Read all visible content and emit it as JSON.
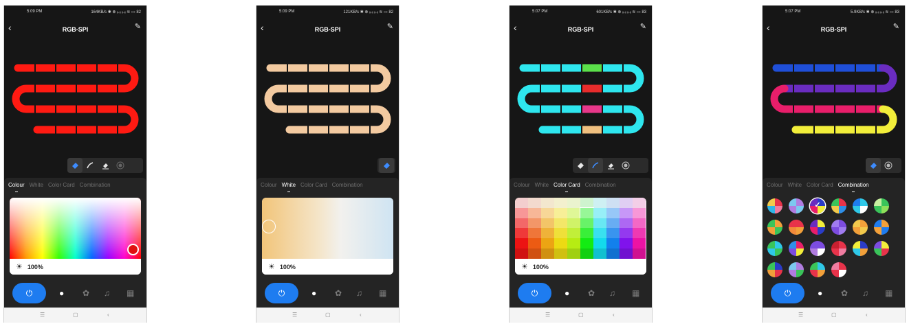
{
  "phones": [
    {
      "status_time": "5:09 PM",
      "status_right": "164KB/s ✱ ⊗ ᵢᵢ.ᵢᵢ ᵢᵢ.ᵢᵢ ≋ ▭ 82",
      "title": "RGB-SPI",
      "back": "‹",
      "edit": "✎",
      "tabs": [
        "Colour",
        "White",
        "Color Card",
        "Combination"
      ],
      "active_tab": "Colour",
      "brightness": "100%"
    },
    {
      "status_time": "5:09 PM",
      "status_right": "121KB/s ✱ ⊗ ᵢᵢ.ᵢᵢ ᵢᵢ.ᵢᵢ ≋ ▭ 82",
      "title": "RGB-SPI",
      "back": "‹",
      "edit": "✎",
      "tabs": [
        "Colour",
        "White",
        "Color Card",
        "Combination"
      ],
      "active_tab": "White",
      "brightness": "100%"
    },
    {
      "status_time": "5:07 PM",
      "status_right": "601KB/s ✱ ⊗ ᵢᵢ.ᵢᵢ ᵢᵢ.ᵢᵢ ≋ ▭ 83",
      "title": "RGB-SPI",
      "back": "‹",
      "edit": "✎",
      "tabs": [
        "Colour",
        "White",
        "Color Card",
        "Combination"
      ],
      "active_tab": "Color Card",
      "brightness": "100%"
    },
    {
      "status_time": "5:07 PM",
      "status_right": "5.9KB/s ✱ ⊗ ᵢᵢ.ᵢᵢ ᵢᵢ.ᵢᵢ ≋ ▭ 83",
      "title": "RGB-SPI",
      "back": "‹",
      "edit": "✎",
      "tabs": [
        "Colour",
        "White",
        "Color Card",
        "Combination"
      ],
      "active_tab": "Combination"
    }
  ],
  "strip_colors": {
    "phone1": {
      "all": "#ff1a12"
    },
    "phone2": {
      "all": "#f3caa0"
    },
    "phone3": {
      "all": "#2ee6ee",
      "accents": [
        "#5be04a",
        "#e82c2c",
        "#e8388a",
        "#f0c080"
      ]
    },
    "phone4": {
      "row1": "#1f4fd8",
      "loop1": "#6a2cc0",
      "row2": "#7b2cc0",
      "loop2": "#e01e5a",
      "row3": "#e81e6a",
      "loop3": "#e8ee2c",
      "row4": "#f2ee3a"
    }
  },
  "accent_color": "#1e7cf0",
  "nav_icons": [
    "power-icon",
    "bulb-icon",
    "palette-icon",
    "music-icon",
    "grid-icon"
  ],
  "system_nav": {
    "menu": "☰",
    "home": "▢",
    "back": "‹"
  }
}
